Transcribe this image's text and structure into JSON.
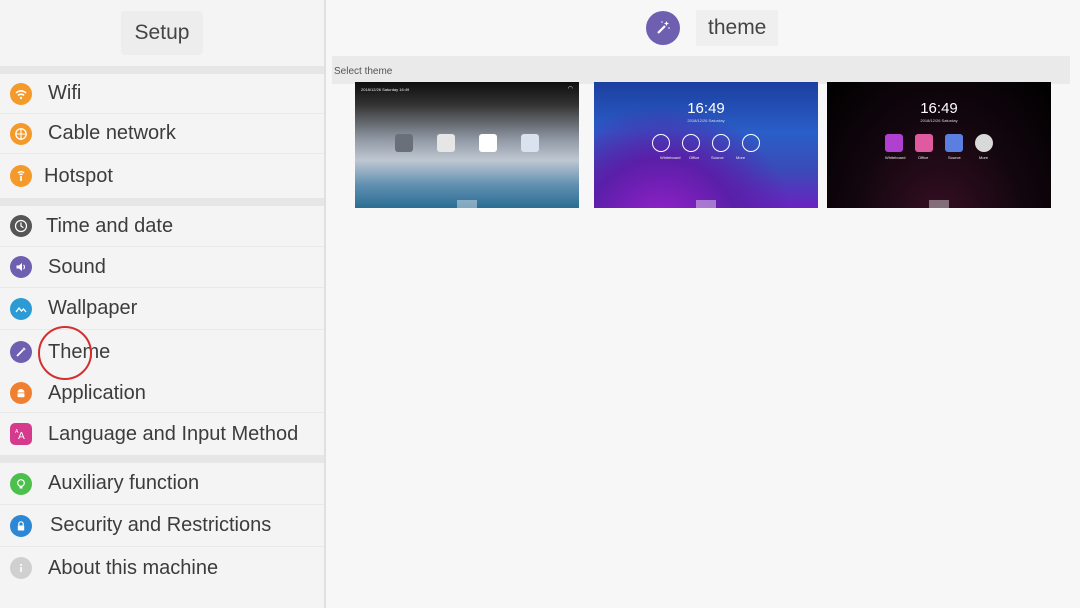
{
  "sidebar": {
    "title": "Setup",
    "items": [
      {
        "label": "Wifi",
        "icon": "wifi-icon",
        "color": "#f39a2a"
      },
      {
        "label": "Cable network",
        "icon": "globe-icon",
        "color": "#f39a2a"
      },
      {
        "label": "Hotspot",
        "icon": "hotspot-icon",
        "color": "#f39a2a"
      },
      {
        "label": "Time and date",
        "icon": "clock-icon",
        "color": "#555555"
      },
      {
        "label": "Sound",
        "icon": "speaker-icon",
        "color": "#6e5fb0"
      },
      {
        "label": "Wallpaper",
        "icon": "picture-icon",
        "color": "#2c9ad4"
      },
      {
        "label": "Theme",
        "icon": "magic-wand-icon",
        "color": "#6e5fb0"
      },
      {
        "label": "Application",
        "icon": "android-icon",
        "color": "#f08030"
      },
      {
        "label": "Language and Input Method",
        "icon": "language-icon",
        "color": "#d63a8c"
      },
      {
        "label": "Auxiliary function",
        "icon": "lightbulb-icon",
        "color": "#4cbf4c"
      },
      {
        "label": "Security and Restrictions",
        "icon": "lock-icon",
        "color": "#2c88d4"
      },
      {
        "label": "About this machine",
        "icon": "info-icon",
        "color": "#d0d0d0"
      }
    ]
  },
  "header": {
    "title": "theme",
    "icon": "magic-wand-icon",
    "accent": "#6e5fb0"
  },
  "section": {
    "label": "Select theme"
  },
  "themes": [
    {
      "name": "theme-1",
      "top_left": "2018/12/26 Saturday 16:49"
    },
    {
      "name": "theme-2",
      "time": "16:49",
      "date": "2018/12/26 Saturday",
      "labels": [
        "Whiteboard",
        "Office",
        "Source",
        "More"
      ]
    },
    {
      "name": "theme-3",
      "time": "16:49",
      "date": "2018/12/26 Saturday",
      "labels": [
        "Whiteboard",
        "Office",
        "Source",
        "More"
      ]
    }
  ]
}
